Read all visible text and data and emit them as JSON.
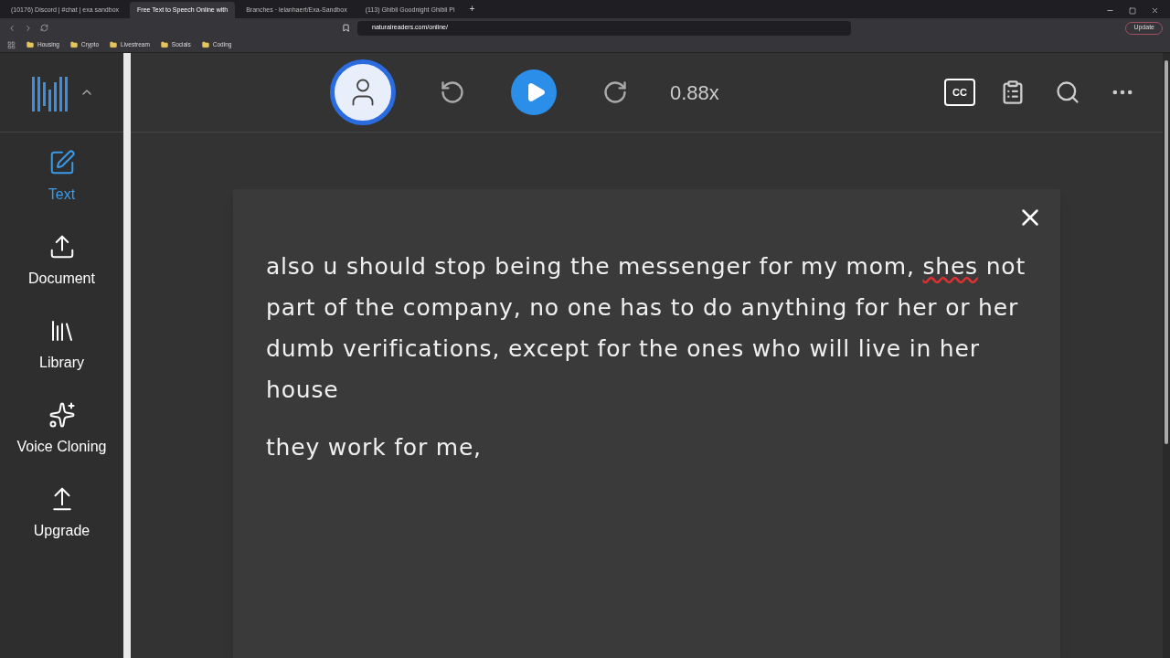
{
  "browser": {
    "tabs": [
      {
        "title": "(10176) Discord | #chat | exa sandbox",
        "selected": false
      },
      {
        "title": "Free Text to Speech Online with",
        "selected": true
      },
      {
        "title": "Branches · lelanhaert/Exa-Sandbox",
        "selected": false
      },
      {
        "title": "(113) Ghibli Goodnight Ghibli Pi",
        "selected": false
      }
    ],
    "address": "naturalreaders.com/online/",
    "bookmarks": [
      "Housing",
      "Crypto",
      "Livestream",
      "Socials",
      "Coding"
    ],
    "new_tab": "+",
    "update": "Update"
  },
  "toolbar": {
    "speed": "0.88x",
    "captions": "CC"
  },
  "sidebar": [
    {
      "kind": "text",
      "label": "Text",
      "selected": true
    },
    {
      "kind": "document",
      "label": "Document",
      "selected": false
    },
    {
      "kind": "library",
      "label": "Library",
      "selected": false
    },
    {
      "kind": "voice",
      "label": "Voice Cloning",
      "selected": false
    },
    {
      "kind": "upgrade",
      "label": "Upgrade",
      "selected": false
    }
  ],
  "document": {
    "paragraphs": [
      [
        {
          "text": "also u should stop being the messenger for my mom, ",
          "misspelled": false
        },
        {
          "text": "shes",
          "misspelled": true
        },
        {
          "text": " not part of the company, no one has to do anything for her or her dumb verifications, except for the ones who will live in her house",
          "misspelled": false
        }
      ],
      [
        {
          "text": "they work for me,",
          "misspelled": false
        }
      ]
    ]
  }
}
